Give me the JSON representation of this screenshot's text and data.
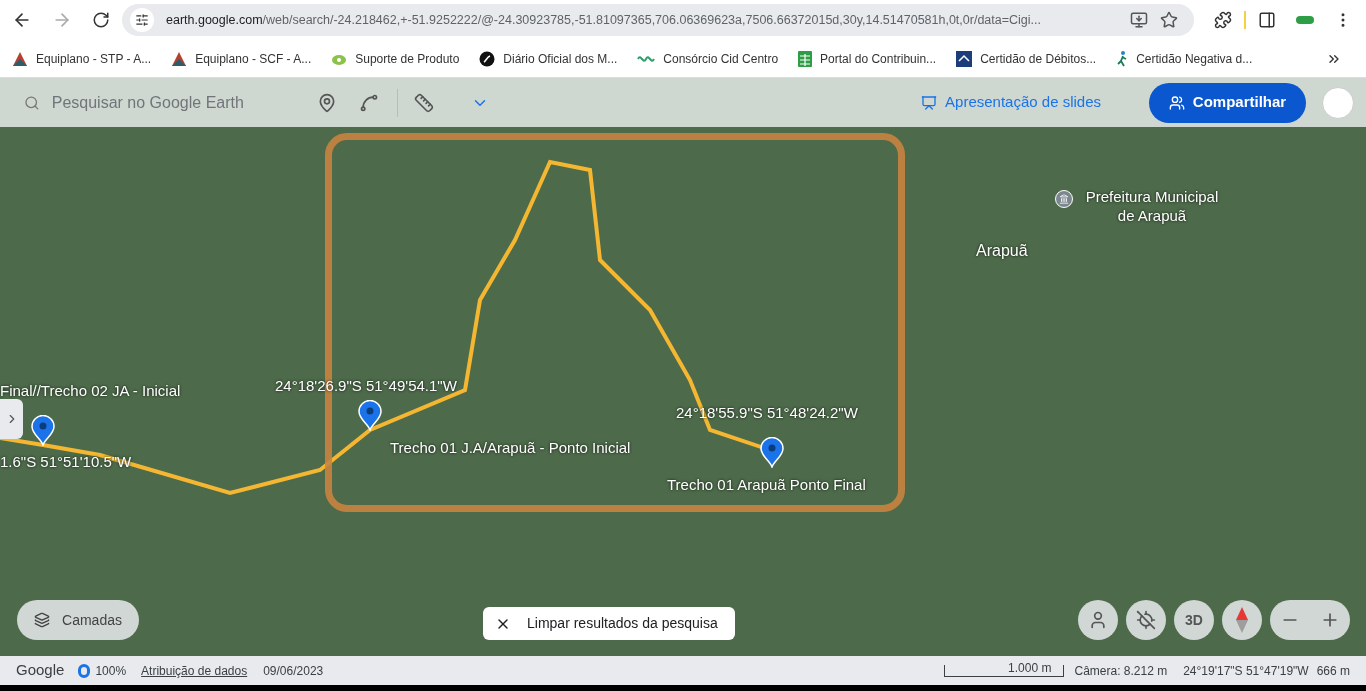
{
  "browser": {
    "url_host": "earth.google.com",
    "url_path": "/web/search/-24.218462,+-51.9252222/@-24.30923785,-51.81097365,706.06369623a,7506.66372015d,30y,14.51470581h,0t,0r/data=Cigi..."
  },
  "bookmarks": [
    {
      "label": "Equiplano - STP - A...",
      "kind": "triangle"
    },
    {
      "label": "Equiplano - SCF - A...",
      "kind": "triangle"
    },
    {
      "label": "Suporte de Produto",
      "kind": "letter"
    },
    {
      "label": "Diário Oficial dos M...",
      "kind": "disc"
    },
    {
      "label": "Consórcio Cid Centro",
      "kind": "wave"
    },
    {
      "label": "Portal do Contribuin...",
      "kind": "sheet"
    },
    {
      "label": "Certidão de Débitos...",
      "kind": "shield"
    },
    {
      "label": "Certidão Negativa d...",
      "kind": "runner"
    }
  ],
  "earth_toolbar": {
    "search": {
      "placeholder": "Pesquisar no Google Earth"
    },
    "slides_link": "Apresentação de slides",
    "share_button": "Compartilhar"
  },
  "map": {
    "pins": [
      {
        "name": "Final//Trecho 02 JA - Inicial",
        "coords": "1.6\"S 51°51'10.5\"W"
      },
      {
        "name": "Trecho 01 J.A/Arapuã - Ponto Inicial",
        "coords": "24°18'26.9\"S 51°49'54.1\"W"
      },
      {
        "name": "Trecho 01 Arapuã Ponto Final",
        "coords": "24°18'55.9\"S 51°48'24.2\"W"
      }
    ],
    "places": [
      {
        "name": "Prefeitura Municipal de Arapuã",
        "kind": "poi"
      },
      {
        "name": "Arapuã",
        "kind": "town"
      }
    ],
    "layers_button": "Camadas",
    "clear_results_button": "Limpar resultados da pesquisa",
    "view_3d_button": "3D"
  },
  "status_bar": {
    "brand": "Google",
    "load": "100%",
    "attribution": "Atribuição de dados",
    "date": "09/06/2023",
    "scale": "1.000 m",
    "camera": "Câmera: 8.212 m",
    "coords": "24°19'17\"S 51°47'19\"W",
    "elevation": "666 m"
  }
}
